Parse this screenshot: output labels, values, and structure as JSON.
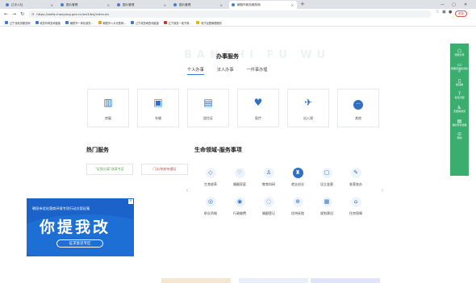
{
  "browser": {
    "tabs": [
      {
        "title": "辽中人社"
      },
      {
        "title": "图片管理"
      },
      {
        "title": "图片管理"
      },
      {
        "title": "图片管理"
      },
      {
        "title": "朝阳市政务服务网"
      }
    ],
    "new_tab_label": "+",
    "url": "https://zwfw.chaoyang.gov.cn/wx3/bsj/index.do",
    "profile_label": "更新",
    "bookmarks": [
      "辽宁省政务服务网",
      "政务外网查询链接",
      "朝阳市一体化政务...",
      "朝阳市人大代表网...",
      "辽宁政务网查询链接",
      "辽宁政务一电子政...",
      "电子证照管理服务"
    ]
  },
  "services": {
    "bg_word": "BANSHI FU WU",
    "title": "办事服务",
    "tabs": [
      "个人办事",
      "法人办事",
      "一件事办理"
    ],
    "cards": [
      {
        "label": "房屋",
        "icon": "building-icon",
        "glyph": "▥"
      },
      {
        "label": "车辆",
        "icon": "car-icon",
        "glyph": "▣"
      },
      {
        "label": "居住证",
        "icon": "id-card-icon",
        "glyph": "▤"
      },
      {
        "label": "医疗",
        "icon": "stethoscope-icon",
        "glyph": "♥"
      },
      {
        "label": "出入境",
        "icon": "plane-icon",
        "glyph": "✈"
      },
      {
        "label": "其他",
        "icon": "more-icon",
        "glyph": "···"
      }
    ]
  },
  "hot": {
    "title": "热门服务",
    "buttons": [
      "\"证照分离\"改革专区",
      "门诊/病房待遇证"
    ]
  },
  "life": {
    "title": "生命领域-服务事项",
    "items": [
      {
        "label": "生育收养",
        "icon": "baby-icon",
        "glyph": "◇"
      },
      {
        "label": "婚姻家庭",
        "icon": "family-icon",
        "glyph": "♡"
      },
      {
        "label": "教育科研",
        "icon": "education-icon",
        "glyph": "♙"
      },
      {
        "label": "就业创业",
        "icon": "briefcase-icon",
        "glyph": "♜",
        "selected": true
      },
      {
        "label": "设立变更",
        "icon": "document-icon",
        "glyph": "▢"
      },
      {
        "label": "准营准办",
        "icon": "edit-icon",
        "glyph": "✎"
      },
      {
        "label": "职业资格",
        "icon": "certificate-icon",
        "glyph": "◎"
      },
      {
        "label": "行政缴费",
        "icon": "payment-icon",
        "glyph": "◉"
      },
      {
        "label": "婚姻登记",
        "icon": "ring-icon",
        "glyph": "◌"
      },
      {
        "label": "优待抚恤",
        "icon": "care-icon",
        "glyph": "⊕"
      },
      {
        "label": "规划建设",
        "icon": "planning-icon",
        "glyph": "▦"
      },
      {
        "label": "住房保障",
        "icon": "house-icon",
        "glyph": "⌂"
      }
    ]
  },
  "sidebar": [
    {
      "label": "智能引导",
      "icon": "robot-icon",
      "glyph": "☖"
    },
    {
      "label": "我要咨询投诉建议",
      "icon": "chat-icon",
      "glyph": "▭"
    },
    {
      "label": "移动端",
      "icon": "mobile-icon",
      "glyph": "▯"
    },
    {
      "label": "常见问题",
      "icon": "help-icon",
      "glyph": "?"
    },
    {
      "label": "无障碍浏览",
      "icon": "accessibility-icon",
      "glyph": "♿"
    },
    {
      "label": "我的评价结果",
      "icon": "evaluate-icon",
      "glyph": "▤"
    },
    {
      "label": "帮助",
      "icon": "help-circle-icon",
      "glyph": "⊙"
    }
  ],
  "promo": {
    "top_text": "朝阳市优化营商环境专项行动方案征集",
    "big_text": "你提我改",
    "button": "征求意见专区",
    "close": "×"
  }
}
